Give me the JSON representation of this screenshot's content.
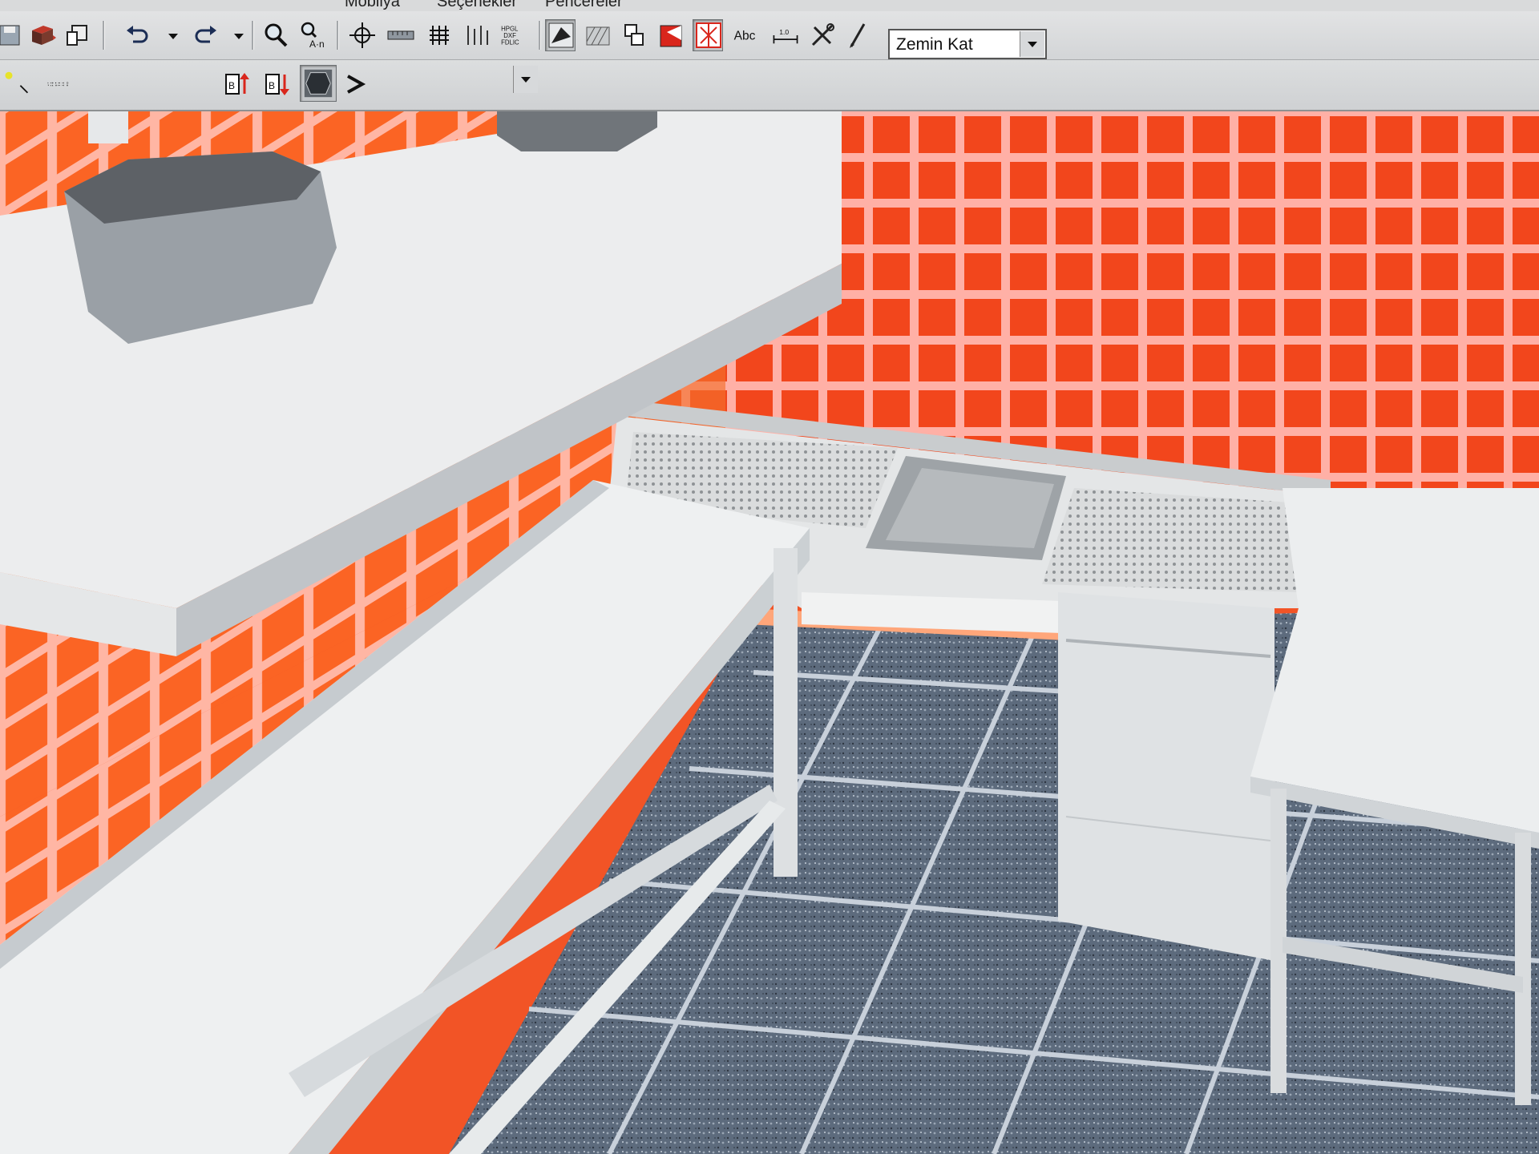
{
  "app": {
    "menus": [
      "Mobilya",
      "Seçenekler",
      "Pencereler"
    ]
  },
  "toolbar": {
    "floor_select": {
      "value": "Zemin Kat"
    },
    "layer_select": {
      "value": ""
    },
    "hpgl_label": "HPGL",
    "dxf_label": "DXF",
    "fdlic_label": "FDLIC",
    "text_tool_label": "Abc",
    "dimension_label": "1.0"
  },
  "icons": [
    "save-icon",
    "cabinet-insert-icon",
    "copy-icon",
    "undo-icon",
    "redo-icon",
    "zoom-icon",
    "zoom-extents-icon",
    "crosshair-icon",
    "ruler-icon",
    "grid-icon",
    "align-icon",
    "export-icon",
    "render-icon",
    "hatch-icon",
    "section-icon",
    "fill-icon",
    "snap-icon",
    "text-icon",
    "dimension-icon",
    "tools-icon",
    "pen-icon",
    "playback-icons",
    "level-up-icon",
    "level-down-icon",
    "3d-view-icon",
    "run-icon"
  ],
  "colors": {
    "tile": "#ff5a22",
    "grout": "#ffb0a6",
    "steel": "#d6d9db",
    "floor": "#5c6a7c"
  }
}
